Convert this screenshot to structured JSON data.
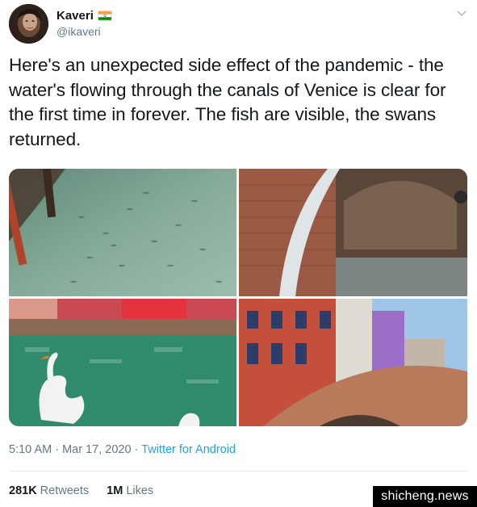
{
  "user": {
    "name": "Kaveri",
    "handle": "@ikaveri",
    "flag_icon": "india-flag-icon"
  },
  "tweet": {
    "text": "Here's an unexpected side effect of the pandemic - the water's flowing through the canals of Venice is clear for the first time in forever. The fish are visible, the swans returned."
  },
  "media": {
    "photos": [
      {
        "icon": "canal-fish-photo"
      },
      {
        "icon": "canal-bridge-underside-photo"
      },
      {
        "icon": "swan-in-canal-photo"
      },
      {
        "icon": "colorful-houses-bridge-photo"
      }
    ]
  },
  "meta": {
    "time": "5:10 AM",
    "separator": " · ",
    "date": "Mar 17, 2020",
    "separator2": " · ",
    "source": "Twitter for Android"
  },
  "stats": {
    "retweets_count": "281K",
    "retweets_label": "Retweets",
    "likes_count": "1M",
    "likes_label": "Likes"
  },
  "watermark": {
    "text": "shicheng.news"
  },
  "colors": {
    "link": "#1da1f2",
    "secondary_text": "#657786",
    "primary_text": "#14171a"
  }
}
